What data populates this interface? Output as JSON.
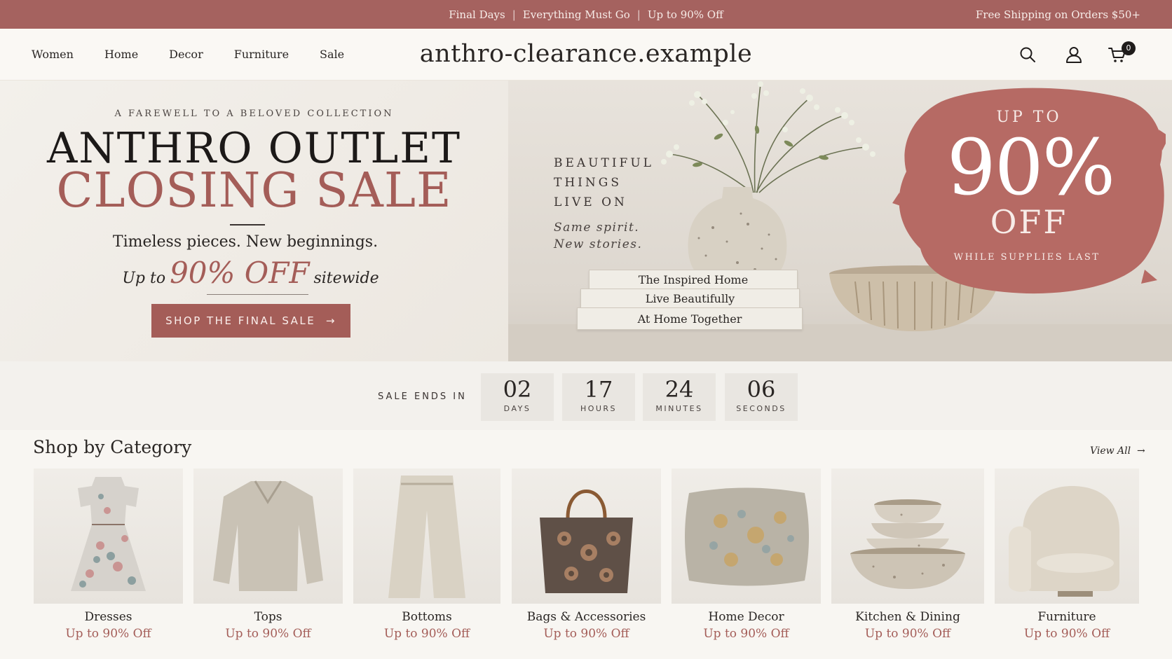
{
  "announcement": {
    "items": [
      "Final Days",
      "Everything Must Go",
      "Up to 90% Off"
    ],
    "separator": "|",
    "right": "Free Shipping on Orders $50+"
  },
  "nav": {
    "links": [
      "Women",
      "Home",
      "Decor",
      "Furniture",
      "Sale"
    ],
    "logo": "anthro-clearance.example",
    "cart_count": "0",
    "icons": [
      "search-icon",
      "account-icon",
      "cart-icon"
    ]
  },
  "hero": {
    "kicker": "A FAREWELL TO A BELOVED COLLECTION",
    "title_line1": "ANTHRO OUTLET",
    "title_line2": "CLOSING SALE",
    "tagline": "Timeless pieces. New beginnings.",
    "offer_prefix": "Up to",
    "offer_big": "90% OFF",
    "offer_suffix": "sitewide",
    "cta": "SHOP THE FINAL SALE",
    "cta_arrow": "→",
    "side_lines": [
      "BEAUTIFUL",
      "THINGS",
      "LIVE ON"
    ],
    "side_sub": [
      "Same spirit.",
      "New stories."
    ],
    "books": [
      "The Inspired Home",
      "Live Beautifully",
      "At Home Together"
    ],
    "badge_top": "UP TO",
    "badge_big": "90%",
    "badge_off": "OFF",
    "badge_note": "WHILE SUPPLIES LAST"
  },
  "countdown": {
    "label": "SALE ENDS IN",
    "units": [
      {
        "value": "02",
        "label": "DAYS"
      },
      {
        "value": "17",
        "label": "HOURS"
      },
      {
        "value": "24",
        "label": "MINUTES"
      },
      {
        "value": "06",
        "label": "SECONDS"
      }
    ]
  },
  "categories": {
    "title": "Shop by Category",
    "view_all": "View All",
    "view_all_arrow": "→",
    "items": [
      {
        "name": "Dresses",
        "offer": "Up to 90% Off"
      },
      {
        "name": "Tops",
        "offer": "Up to 90% Off"
      },
      {
        "name": "Bottoms",
        "offer": "Up to 90% Off"
      },
      {
        "name": "Bags & Accessories",
        "offer": "Up to 90% Off"
      },
      {
        "name": "Home Decor",
        "offer": "Up to 90% Off"
      },
      {
        "name": "Kitchen & Dining",
        "offer": "Up to 90% Off"
      },
      {
        "name": "Furniture",
        "offer": "Up to 90% Off"
      }
    ]
  },
  "colors": {
    "accent": "#a45d58",
    "announce_bg": "#a5625f",
    "page_bg": "#f8f6f2"
  }
}
